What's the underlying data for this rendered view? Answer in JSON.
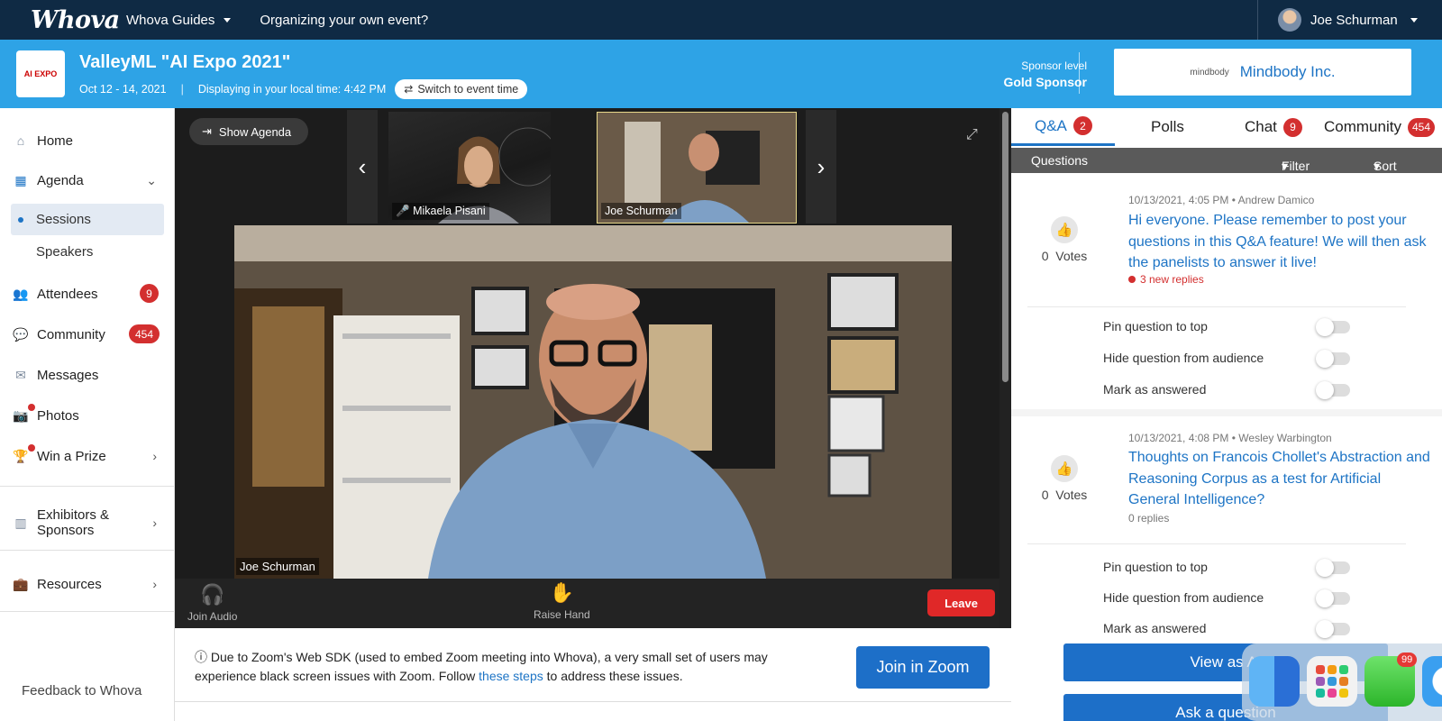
{
  "topbar": {
    "logo": "Whova",
    "nav": [
      "Whova Guides",
      "Organizing your own event?"
    ],
    "user_name": "Joe Schurman"
  },
  "event": {
    "logo_text": "AI EXPO",
    "title": "ValleyML \"AI Expo 2021\"",
    "dates": "Oct 12 - 14, 2021",
    "separator": "|",
    "local_time": "Displaying in your local time: 4:42 PM",
    "switch_label": "Switch to event time",
    "sponsor_level_label": "Sponsor level",
    "sponsor_level": "Gold Sponsor",
    "sponsor_small": "mindbody",
    "sponsor_name": "Mindbody Inc."
  },
  "sidebar": {
    "home": "Home",
    "agenda": "Agenda",
    "sessions": "Sessions",
    "speakers": "Speakers",
    "attendees": "Attendees",
    "attendees_badge": "9",
    "community": "Community",
    "community_badge": "454",
    "messages": "Messages",
    "photos": "Photos",
    "prize": "Win a Prize",
    "exhibitors_line1": "Exhibitors &",
    "exhibitors_line2": "Sponsors",
    "resources": "Resources",
    "feedback": "Feedback to Whova"
  },
  "video": {
    "show_agenda": "Show Agenda",
    "thumb1_name": "Mikaela Pisani",
    "thumb2_name": "Joe Schurman",
    "main_name": "Joe Schurman",
    "join_audio": "Join Audio",
    "raise_hand": "Raise Hand",
    "leave": "Leave"
  },
  "zoom_note": {
    "text_before": "Due to Zoom's Web SDK (used to embed Zoom meeting into Whova), a very small set of users may experience black screen issues with Zoom. Follow",
    "link": "these steps",
    "text_after": "to address these issues.",
    "join_button": "Join in Zoom"
  },
  "panel": {
    "tabs": {
      "qa": "Q&A",
      "qa_badge": "2",
      "polls": "Polls",
      "chat": "Chat",
      "chat_badge": "9",
      "community": "Community",
      "community_badge": "454"
    },
    "questions_label": "Questions",
    "filter_by": "Filter by",
    "sort_by": "Sort by",
    "questions": [
      {
        "votes": "0",
        "votes_label": "Votes",
        "meta": "10/13/2021, 4:05 PM • Andrew Damico",
        "text": "Hi everyone. Please remember to post your questions in this Q&A feature! We will then ask the panelists to answer it live!",
        "replies": "3 new replies"
      },
      {
        "votes": "0",
        "votes_label": "Votes",
        "meta": "10/13/2021, 4:08 PM • Wesley Warbington",
        "text": "Thoughts on Francois Chollet's Abstraction and Reasoning Corpus as a test for Artificial General Intelligence?",
        "replies": "0 replies"
      }
    ],
    "options": {
      "pin": "Pin question to top",
      "hide": "Hide question from audience",
      "answered": "Mark as answered"
    },
    "view_all": "View as At",
    "ask": "Ask a question"
  },
  "dock": {
    "messages_badge": "99"
  }
}
